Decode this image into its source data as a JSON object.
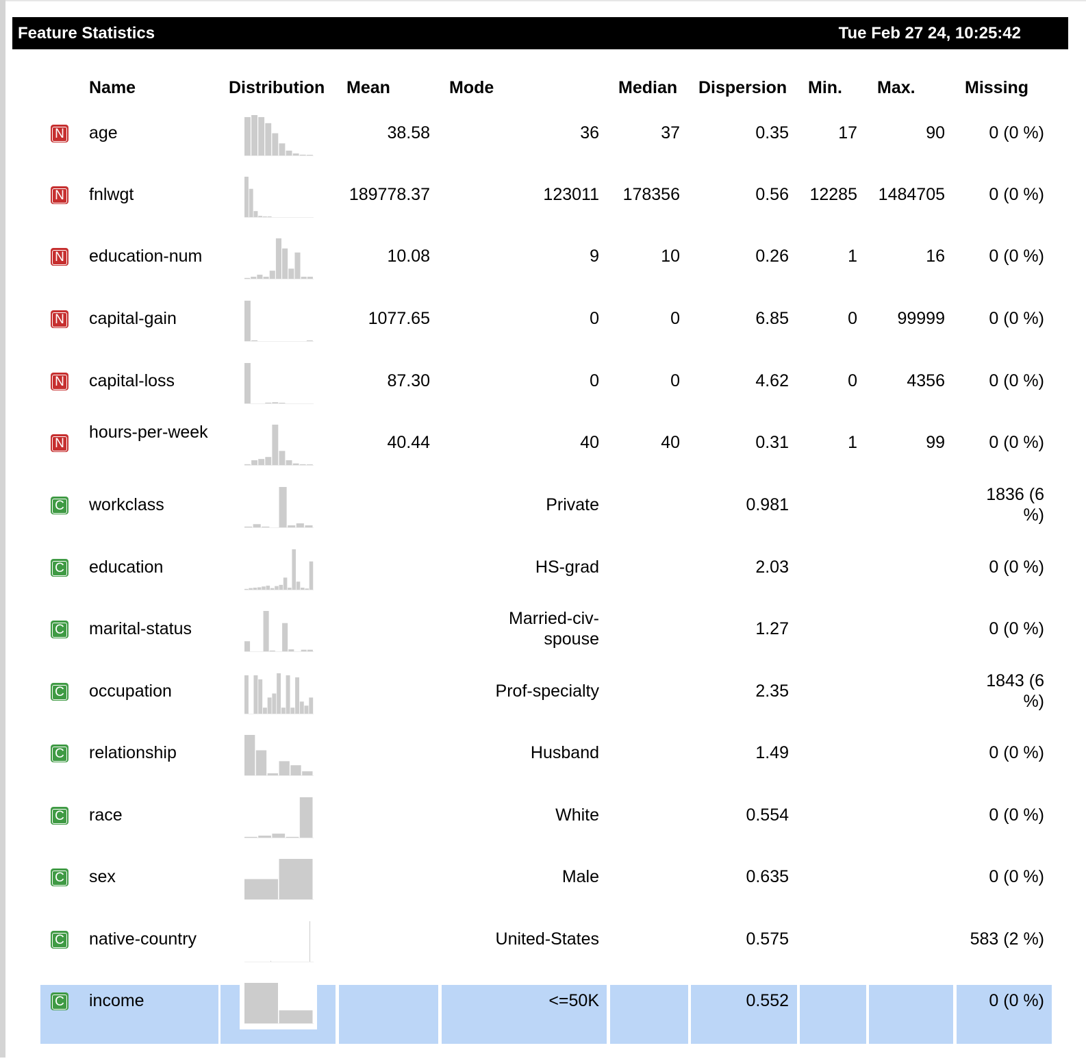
{
  "title": "Feature Statistics",
  "timestamp": "Tue Feb 27 24, 10:25:42",
  "headers": {
    "name": "Name",
    "distribution": "Distribution",
    "mean": "Mean",
    "mode": "Mode",
    "median": "Median",
    "dispersion": "Dispersion",
    "min": "Min.",
    "max": "Max.",
    "missing": "Missing"
  },
  "colors": {
    "numeric_badge": "#c62f2f",
    "categorical_badge": "#3f9a44",
    "selected_row": "#bcd6f7",
    "histogram_bar": "#cccccc"
  },
  "rows": [
    {
      "type": "N",
      "name": "age",
      "mean": "38.58",
      "mode": "36",
      "median": "37",
      "dispersion": "0.35",
      "min": "17",
      "max": "90",
      "missing": "0 (0 %)",
      "hist": [
        0.95,
        1.0,
        0.95,
        0.8,
        0.55,
        0.3,
        0.12,
        0.05,
        0.02,
        0.01
      ]
    },
    {
      "type": "N",
      "name": "fnlwgt",
      "mean": "189778.37",
      "mode": "123011",
      "median": "178356",
      "dispersion": "0.56",
      "min": "12285",
      "max": "1484705",
      "missing": "0 (0 %)",
      "hist": [
        1.0,
        0.7,
        0.15,
        0.03,
        0.01,
        0.005,
        0,
        0,
        0,
        0,
        0,
        0,
        0,
        0,
        0
      ]
    },
    {
      "type": "N",
      "name": "education-num",
      "mean": "10.08",
      "mode": "9",
      "median": "10",
      "dispersion": "0.26",
      "min": "1",
      "max": "16",
      "missing": "0 (0 %)",
      "hist": [
        0.02,
        0.05,
        0.1,
        0.05,
        0.2,
        1.0,
        0.75,
        0.25,
        0.65,
        0.05,
        0.05
      ]
    },
    {
      "type": "N",
      "name": "capital-gain",
      "mean": "1077.65",
      "mode": "0",
      "median": "0",
      "dispersion": "6.85",
      "min": "0",
      "max": "99999",
      "missing": "0 (0 %)",
      "hist": [
        1.0,
        0.02,
        0,
        0,
        0,
        0,
        0,
        0,
        0,
        0.01
      ]
    },
    {
      "type": "N",
      "name": "capital-loss",
      "mean": "87.30",
      "mode": "0",
      "median": "0",
      "dispersion": "4.62",
      "min": "0",
      "max": "4356",
      "missing": "0 (0 %)",
      "hist": [
        1.0,
        0,
        0,
        0.02,
        0.03,
        0.01,
        0,
        0,
        0,
        0
      ]
    },
    {
      "type": "N",
      "name": "hours-per-week",
      "mean": "40.44",
      "mode": "40",
      "median": "40",
      "dispersion": "0.31",
      "min": "1",
      "max": "99",
      "missing": "0 (0 %)",
      "hist": [
        0.02,
        0.12,
        0.15,
        0.2,
        1.0,
        0.35,
        0.12,
        0.04,
        0.02,
        0.01
      ]
    },
    {
      "type": "C",
      "name": "workclass",
      "mean": "",
      "mode": "Private",
      "median": "",
      "dispersion": "0.981",
      "min": "",
      "max": "",
      "missing": "1836 (6 %)",
      "hist": [
        0.02,
        0.08,
        0.02,
        0,
        1.0,
        0.05,
        0.1,
        0.05
      ]
    },
    {
      "type": "C",
      "name": "education",
      "mean": "",
      "mode": "HS-grad",
      "median": "",
      "dispersion": "2.03",
      "min": "",
      "max": "",
      "missing": "0 (0 %)",
      "hist": [
        0.02,
        0.04,
        0.05,
        0.06,
        0.08,
        0.1,
        0.04,
        0.09,
        0.12,
        0.3,
        0.05,
        1.0,
        0.2,
        0.05,
        0.03,
        0.7
      ]
    },
    {
      "type": "C",
      "name": "marital-status",
      "mean": "",
      "mode": "Married-civ-spouse",
      "median": "",
      "dispersion": "1.27",
      "min": "",
      "max": "",
      "missing": "0 (0 %)",
      "hist": [
        0.25,
        0,
        0,
        1.0,
        0.02,
        0,
        0.7,
        0.05,
        0,
        0.04,
        0.04
      ]
    },
    {
      "type": "C",
      "name": "occupation",
      "mean": "",
      "mode": "Prof-specialty",
      "median": "",
      "dispersion": "2.35",
      "min": "",
      "max": "",
      "missing": "1843 (6 %)",
      "hist": [
        0.95,
        0,
        0.95,
        0.85,
        0.15,
        0.4,
        0.5,
        1.0,
        0.15,
        0.95,
        0.15,
        0.9,
        0.3,
        0.2,
        0.4
      ]
    },
    {
      "type": "C",
      "name": "relationship",
      "mean": "",
      "mode": "Husband",
      "median": "",
      "dispersion": "1.49",
      "min": "",
      "max": "",
      "missing": "0 (0 %)",
      "hist": [
        1.0,
        0.62,
        0.05,
        0.35,
        0.25,
        0.1
      ]
    },
    {
      "type": "C",
      "name": "race",
      "mean": "",
      "mode": "White",
      "median": "",
      "dispersion": "0.554",
      "min": "",
      "max": "",
      "missing": "0 (0 %)",
      "hist": [
        0.02,
        0.05,
        0.1,
        0.02,
        1.0
      ]
    },
    {
      "type": "C",
      "name": "sex",
      "mean": "",
      "mode": "Male",
      "median": "",
      "dispersion": "0.635",
      "min": "",
      "max": "",
      "missing": "0 (0 %)",
      "hist": [
        0.5,
        1.0
      ]
    },
    {
      "type": "C",
      "name": "native-country",
      "mean": "",
      "mode": "United-States",
      "median": "",
      "dispersion": "0.575",
      "min": "",
      "max": "",
      "missing": "583 (2 %)",
      "hist": [
        0,
        0,
        0,
        0,
        0,
        0,
        0,
        0,
        0,
        0,
        0,
        0,
        0,
        0,
        0,
        0,
        0,
        0,
        0,
        0,
        0,
        0,
        0,
        0,
        0,
        0,
        0,
        0,
        0,
        0,
        0,
        0,
        0,
        0,
        0,
        0,
        0,
        0,
        0.02,
        0,
        0,
        0,
        0,
        0,
        0,
        0,
        0,
        0,
        0,
        0,
        0,
        0,
        0,
        0,
        0,
        0,
        0,
        0,
        0,
        0,
        0,
        0,
        0,
        0,
        0,
        0,
        0,
        0,
        0,
        0,
        0,
        0,
        0,
        0,
        0,
        0,
        0,
        0,
        0,
        0,
        0,
        0,
        0,
        0,
        0,
        0,
        0,
        0,
        0,
        0,
        0,
        0,
        0,
        0,
        0,
        1.0,
        0,
        0,
        0,
        0,
        0
      ]
    },
    {
      "type": "C",
      "name": "income",
      "mean": "",
      "mode": "<=50K",
      "median": "",
      "dispersion": "0.552",
      "min": "",
      "max": "",
      "missing": "0 (0 %)",
      "selected": true,
      "hist": [
        1.0,
        0.32
      ]
    }
  ]
}
